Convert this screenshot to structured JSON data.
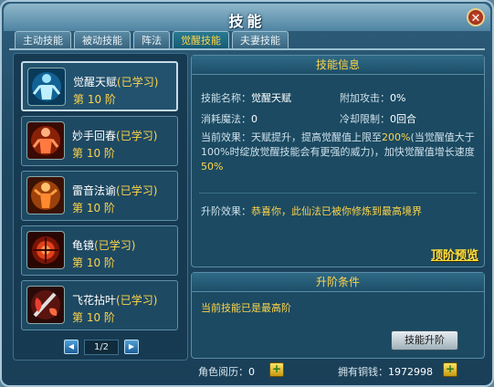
{
  "window": {
    "title": "技能",
    "close_icon": "close-icon"
  },
  "tabs": [
    {
      "label": "主动技能"
    },
    {
      "label": "被动技能"
    },
    {
      "label": "阵法"
    },
    {
      "label": "觉醒技能"
    },
    {
      "label": "夫妻技能"
    }
  ],
  "active_tab": "觉醒技能",
  "skills": [
    {
      "name": "觉醒天赋",
      "status": "(已学习)",
      "level": "第 10 阶",
      "icon": "awaken-figure-icon",
      "color": "#3ab6ff"
    },
    {
      "name": "妙手回春",
      "status": "(已学习)",
      "level": "第 10 阶",
      "icon": "healing-figure-icon",
      "color": "#ff5a2a"
    },
    {
      "name": "雷音法谕",
      "status": "(已学习)",
      "level": "第 10 阶",
      "icon": "thunder-figure-icon",
      "color": "#ff7a20"
    },
    {
      "name": "龟镜",
      "status": "(已学习)",
      "level": "第 10 阶",
      "icon": "shield-mirror-icon",
      "color": "#e0401a"
    },
    {
      "name": "飞花拈叶",
      "status": "(已学习)",
      "level": "第 10 阶",
      "icon": "flying-leaf-icon",
      "color": "#e84030"
    }
  ],
  "pager": {
    "text": "1/2",
    "prev_icon": "prev-arrow-icon",
    "next_icon": "next-arrow-icon"
  },
  "info": {
    "header": "技能信息",
    "name_label": "技能名称：",
    "name_value": "觉醒天赋",
    "attack_label": "附加攻击：",
    "attack_value": "0%",
    "mana_label": "消耗魔法：",
    "mana_value": "0",
    "cooldown_label": "冷却限制：",
    "cooldown_value": "0回合",
    "effect_label": "当前效果：",
    "effect_part1": "天赋提升，提高觉醒值上限至",
    "effect_highlight1": "200%",
    "effect_part2": "(当觉醒值大于100%时绽放觉醒技能会有更强的威力)，加快觉醒值增长速度",
    "effect_highlight2": "50%",
    "advance_label": "升阶效果：",
    "advance_value": "恭喜你，此仙法已被你修炼到最高境界",
    "preview_link": "顶阶预览"
  },
  "conditions": {
    "header": "升阶条件",
    "text": "当前技能已是最高阶",
    "upgrade_button": "技能升阶"
  },
  "footer": {
    "experience_label": "角色阅历：",
    "experience_value": "0",
    "copper_label": "拥有铜钱：",
    "copper_value": "1972998"
  },
  "colors": {
    "accent_yellow": "#ffd54a",
    "panel_blue": "#1b4a62"
  }
}
